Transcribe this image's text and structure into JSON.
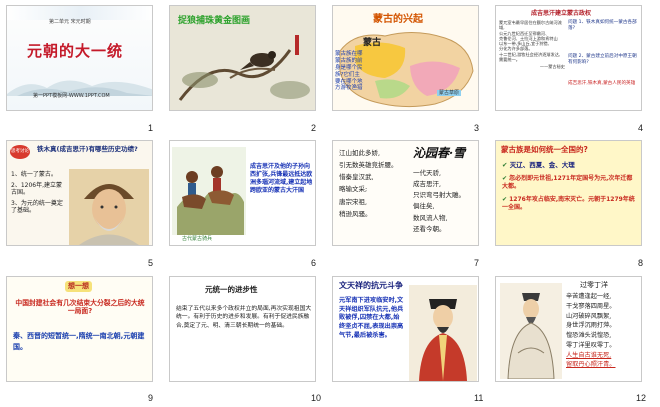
{
  "slides": [
    {
      "num": "1",
      "section": "第二单元 宋元时期",
      "title": "元朝的大一统",
      "footer": "第一PPT模板网-WWW.1PPT.COM"
    },
    {
      "num": "2",
      "title": "捉狼捕珠黄金图画"
    },
    {
      "num": "3",
      "title": "蒙古的兴起",
      "map_label": "蒙古",
      "caption_lines": [
        "蒙古族在哪",
        "蒙古族的前",
        "身是哪个民",
        "族?它们主",
        "要在哪个地",
        "方游牧渔猎"
      ],
      "region_label": "蒙古草原"
    },
    {
      "num": "4",
      "header": "成吉思汗建立蒙古政权",
      "body_lines": [
        "蒙兀室韦最早居住在额尔古纳河流域,",
        "公元九世纪西迁至鄂嫩河、",
        "克鲁伦河、土拉河上游和肯特山",
        "以东一带,多山丘,宜于狩猎,",
        "分化为许多部落。",
        "十二世纪,游牧社会经济逐渐发达,",
        "需要统一。"
      ],
      "source": "——蒙古秘史",
      "q1": "问题 1、铁木真如何统一蒙古各部落?",
      "q2": "问题 2、蒙古建立前后对中原王朝有何影响?",
      "note": "成吉思汗,铁木真,蒙古人民的英雄"
    },
    {
      "num": "5",
      "badge": "思考讨论",
      "question": "铁木真(成吉思汗)有哪些历史功绩?",
      "items": [
        "1、统一了蒙古。",
        "2、1206年,建立蒙古国。",
        "3、为元的统一奠定了基础。"
      ]
    },
    {
      "num": "6",
      "caption": "古代蒙古骑兵",
      "text": "成吉思汗及他的子孙向西扩张,兵锋最远抵达欧洲多瑙河流域,建立起地跨欧亚的蒙古大汗国"
    },
    {
      "num": "7",
      "poem_title": "沁园春·雪",
      "poem_left": [
        "江山如此多娇,",
        "引无数英雄竞折腰。",
        "惜秦皇汉武,",
        "略输文采;",
        "唐宗宋祖,",
        "稍逊风骚。"
      ],
      "poem_right": [
        "一代天骄,",
        "成吉思汗,",
        "只识弯弓射大雕。",
        "俱往矣,",
        "数风流人物,",
        "还看今朝。"
      ]
    },
    {
      "num": "8",
      "title": "蒙古族是如何统一全国的?",
      "items": [
        "灭辽、西夏、金、大理",
        "忽必烈即元世祖,1271年定国号为元,次年迁都大都。",
        "1276年攻占临安,南宋灭亡。元朝于1279年统一全国。"
      ]
    },
    {
      "num": "9",
      "badge": "想一想",
      "question": "中国封建社会有几次结束大分裂之后的大统一局面?",
      "answer": "秦、西晋的短暂统一,隋统一南北朝,元朝建国。"
    },
    {
      "num": "10",
      "title": "元统一的进步性",
      "body": "结束了五代以来多个政权并立的局面,再次实现祖国大统一。有利于历史的进步和发展。有利于促进民族融合,奠定了元、明、清三朝长期统一的基础。"
    },
    {
      "num": "11",
      "title": "文天祥的抗元斗争",
      "body": "元军南下进攻临安时,文天祥组织军队抗元,他兵败被俘,囚禁在大都,始终坚贞不屈,表现出崇高气节,最后被杀害。"
    },
    {
      "num": "12",
      "poem_title": "过零丁洋",
      "lines": [
        "辛苦遭逢起一经,",
        "干戈寥落四周星。",
        "山河破碎风飘絮,",
        "身世浮沉雨打萍。",
        "惶恐滩头说惶恐,",
        "零丁洋里叹零丁。"
      ],
      "lines_red": [
        "人生自古谁无死,",
        "留取丹心照汗青。"
      ]
    }
  ]
}
